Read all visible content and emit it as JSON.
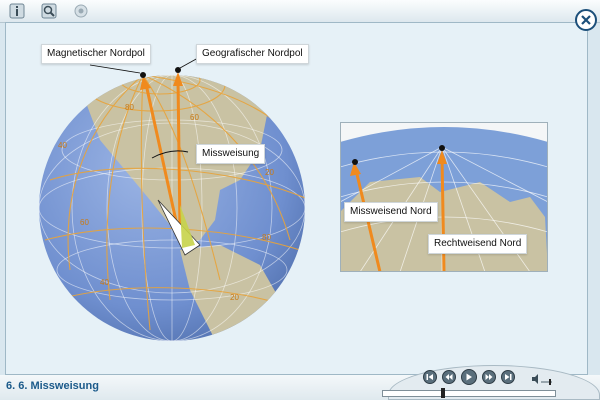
{
  "toolbar": {
    "buttons": [
      {
        "icon": "info-icon"
      },
      {
        "icon": "magnifier-icon"
      },
      {
        "icon": "settings-icon"
      }
    ]
  },
  "close_icon": "close-icon",
  "labels": {
    "magnetic_pole": "Magnetischer Nordpol",
    "geographic_pole": "Geografischer Nordpol",
    "declination": "Missweisung",
    "magnetic_north": "Missweisend Nord",
    "true_north": "Rechtweisend Nord"
  },
  "contour_values": [
    "40",
    "60",
    "20",
    "80",
    "40",
    "20",
    "80",
    "60"
  ],
  "footer": {
    "section_title": "6. 6. Missweisung"
  },
  "player": {
    "buttons": [
      "skip-back-icon",
      "rewind-icon",
      "play-icon",
      "fast-forward-icon",
      "skip-forward-icon"
    ],
    "volume_icon": "speaker-icon",
    "progress": 0.35
  },
  "colors": {
    "ocean": "#6f8fcf",
    "land": "#c9c2a3",
    "contour": "#e8a33a",
    "arrow": "#f08a1e",
    "accent": "#1b5a8a"
  }
}
